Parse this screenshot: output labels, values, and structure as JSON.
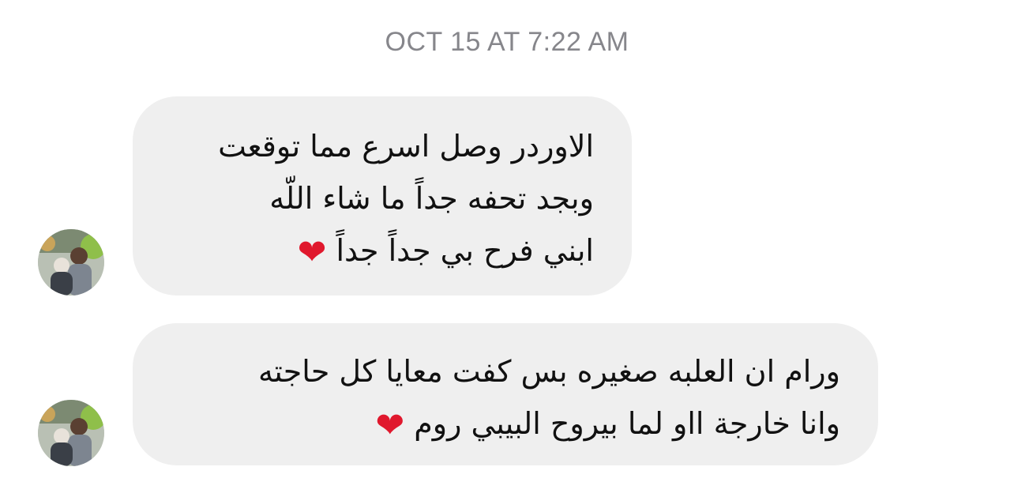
{
  "thread": {
    "timestamp": "OCT 15 AT 7:22 AM"
  },
  "messages": [
    {
      "lines": [
        "الاوردر وصل اسرع مما توقعت",
        "وبجد تحفه جداً ما شاء اللّه",
        "ابني فرح بي جداً جداً"
      ],
      "emoji": "heart-icon"
    },
    {
      "lines": [
        "ورام ان العلبه صغيره بس كفت معايا كل حاجته",
        "وانا خارجة اا‌و لما بيروح البيبي روم"
      ],
      "emoji": "heart-icon"
    }
  ],
  "emoji_glyph": "❤",
  "colors": {
    "bubble": "#efefef",
    "timestamp": "#86868b",
    "heart": "#e0182d"
  }
}
